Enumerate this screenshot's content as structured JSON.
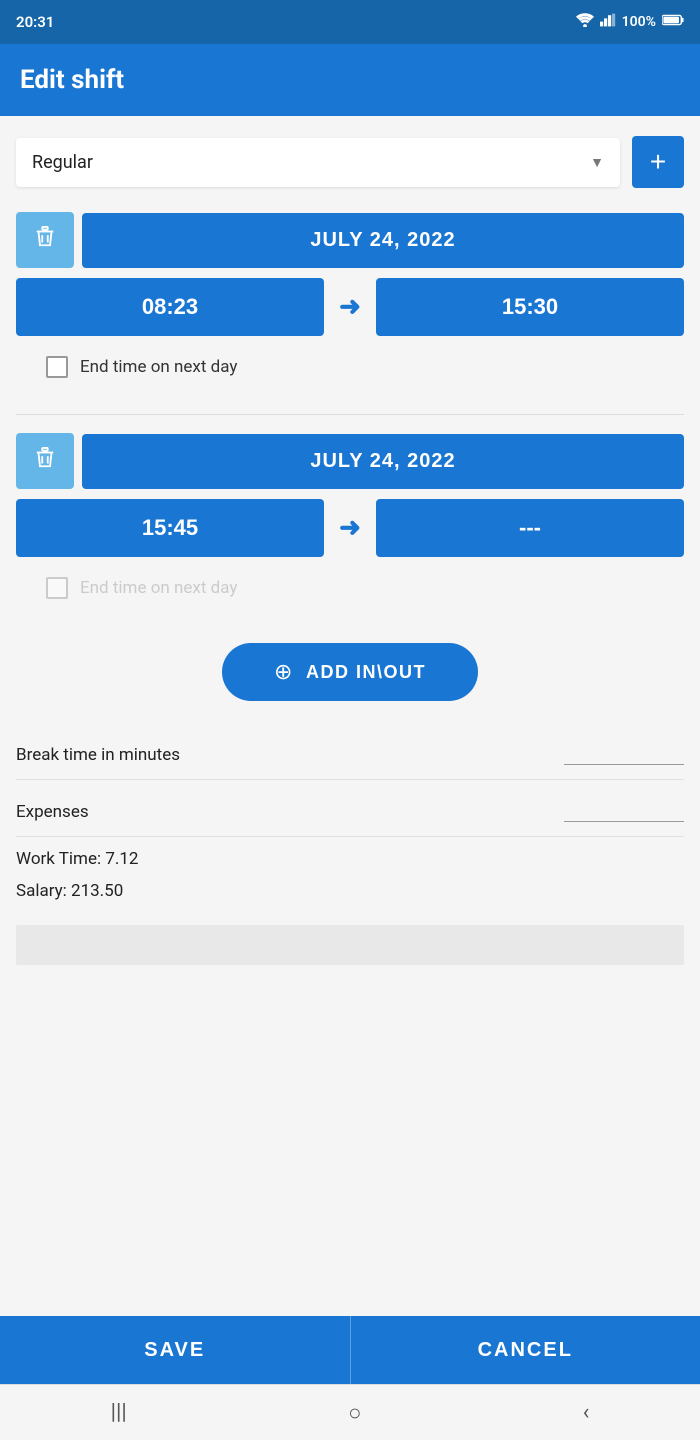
{
  "statusBar": {
    "time": "20:31",
    "battery": "100%"
  },
  "header": {
    "title": "Edit shift"
  },
  "shiftType": {
    "label": "Regular",
    "addButtonLabel": "+"
  },
  "shiftBlock1": {
    "date": "JULY 24, 2022",
    "startTime": "08:23",
    "endTime": "15:30",
    "endTimeNextDay": "End time on next day",
    "deleteLabel": "delete"
  },
  "shiftBlock2": {
    "date": "JULY 24, 2022",
    "startTime": "15:45",
    "endTime": "---",
    "endTimeNextDay": "End time on next day",
    "deleteLabel": "delete"
  },
  "addInOut": {
    "label": "ADD IN\\OUT"
  },
  "breakTime": {
    "label": "Break time in minutes"
  },
  "expenses": {
    "label": "Expenses"
  },
  "workTime": {
    "label": "Work Time: 7.12"
  },
  "salary": {
    "label": "Salary: 213.50"
  },
  "buttons": {
    "save": "SAVE",
    "cancel": "CANCEL"
  },
  "nav": {
    "menu": "|||",
    "home": "○",
    "back": "‹"
  }
}
